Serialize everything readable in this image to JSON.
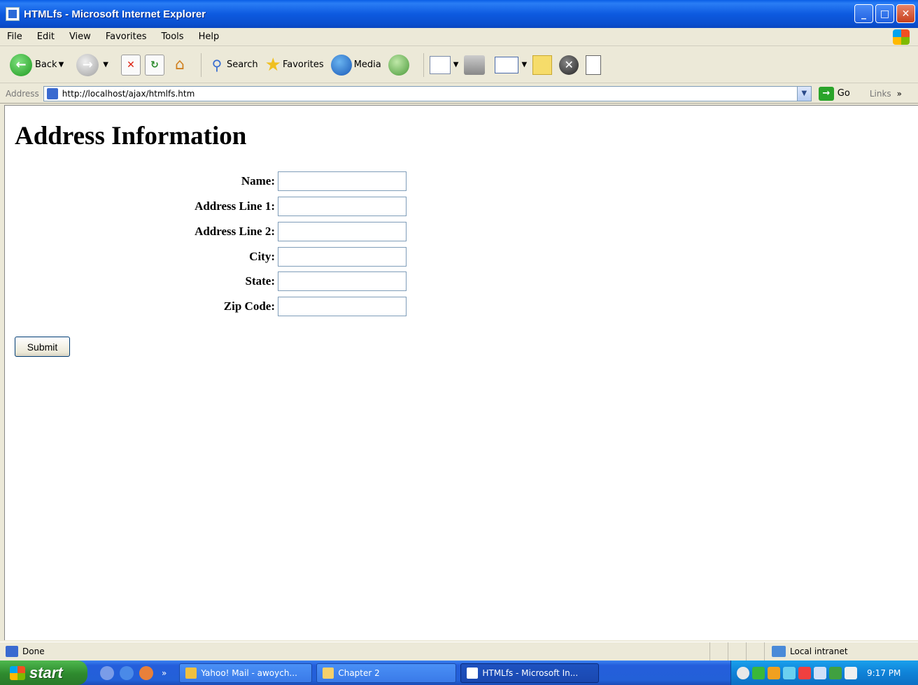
{
  "window": {
    "title": "HTMLfs - Microsoft Internet Explorer",
    "minimize_glyph": "_",
    "maximize_glyph": "□",
    "close_glyph": "✕"
  },
  "menu": {
    "items": [
      "File",
      "Edit",
      "View",
      "Favorites",
      "Tools",
      "Help"
    ]
  },
  "toolbar": {
    "back": "Back",
    "search": "Search",
    "favorites": "Favorites",
    "media": "Media"
  },
  "address": {
    "label": "Address",
    "url": "http://localhost/ajax/htmlfs.htm",
    "go": "Go",
    "links": "Links",
    "more": "»"
  },
  "page": {
    "heading": "Address Information",
    "fields": [
      {
        "label": "Name:",
        "value": ""
      },
      {
        "label": "Address Line 1:",
        "value": ""
      },
      {
        "label": "Address Line 2:",
        "value": ""
      },
      {
        "label": "City:",
        "value": ""
      },
      {
        "label": "State:",
        "value": ""
      },
      {
        "label": "Zip Code:",
        "value": ""
      }
    ],
    "submit": "Submit"
  },
  "status": {
    "text": "Done",
    "zone": "Local intranet"
  },
  "taskbar": {
    "start": "start",
    "quicklaunch_more": "»",
    "tasks": [
      {
        "label": "Yahoo! Mail - awoych...",
        "active": false
      },
      {
        "label": "Chapter 2",
        "active": false
      },
      {
        "label": "HTMLfs - Microsoft In...",
        "active": true
      }
    ],
    "clock": "9:17 PM"
  }
}
